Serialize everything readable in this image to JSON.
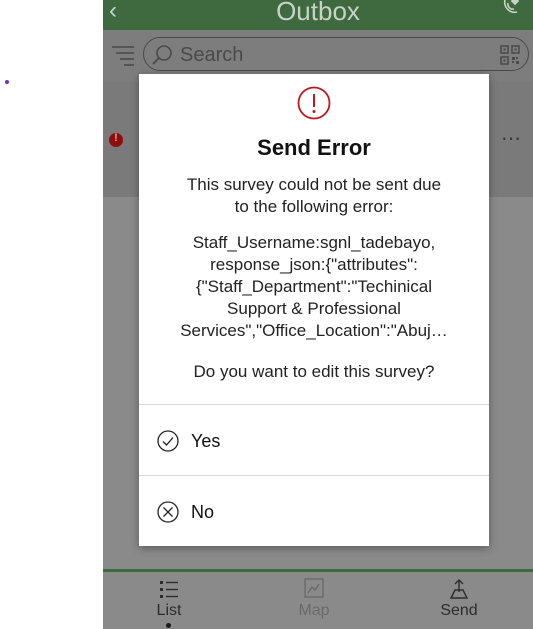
{
  "header": {
    "back_icon": "chevron-left-icon",
    "title": "Outbox",
    "gps_icon": "satellite-signal-icon"
  },
  "search": {
    "placeholder": "Search",
    "filter_icon": "filter-list-icon",
    "search_icon": "magnifier-icon",
    "qr_icon": "qr-code-icon"
  },
  "list": {
    "item_status_icon": "error-dot-icon",
    "item_menu": "⋯"
  },
  "dialog": {
    "icon": "exclamation-circle-icon",
    "title": "Send Error",
    "message": "This survey could not be sent due\nto the following error:",
    "error_detail": "Staff_Username:sgnl_tadebayo,\nresponse_json:{\"attributes\":\n{\"Staff_Department\":\"Techinical\nSupport & Professional\nServices\",\"Office_Location\":\"Abuj…",
    "question": "Do you want to edit this survey?",
    "yes_label": "Yes",
    "no_label": "No"
  },
  "tabs": [
    {
      "label": "List",
      "icon": "list-icon",
      "active": true
    },
    {
      "label": "Map",
      "icon": "map-icon",
      "active": false
    },
    {
      "label": "Send",
      "icon": "send-upload-icon",
      "active": false
    }
  ],
  "colors": {
    "accent_green": "#3f6a3f",
    "error_red": "#c0161f",
    "overlay_gray": "#8a8a8a"
  }
}
